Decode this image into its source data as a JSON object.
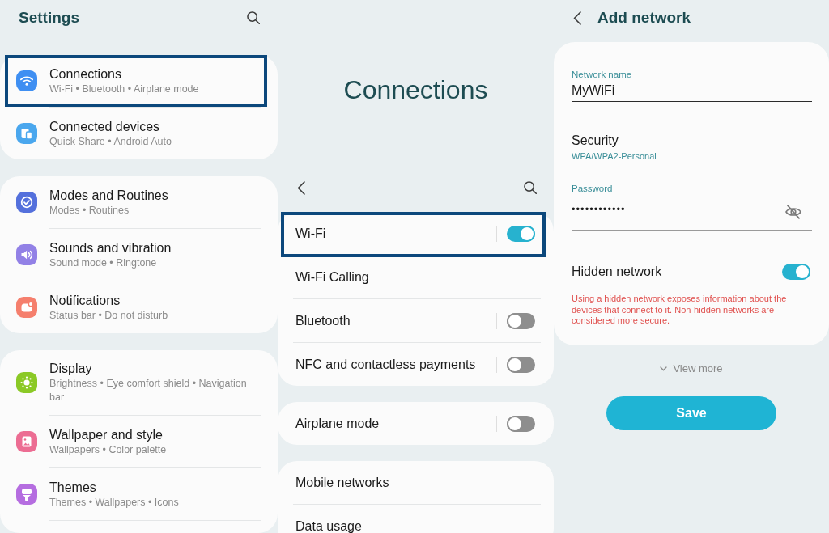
{
  "settings_panel": {
    "title": "Settings",
    "groups": [
      {
        "items": [
          {
            "title": "Connections",
            "subtitle": "Wi-Fi • Bluetooth • Airplane mode",
            "color": "#3f8ff2",
            "highlighted": true
          },
          {
            "title": "Connected devices",
            "subtitle": "Quick Share • Android Auto",
            "color": "#4aa7ee",
            "highlighted": false
          }
        ]
      },
      {
        "items": [
          {
            "title": "Modes and Routines",
            "subtitle": "Modes • Routines",
            "color": "#5470dc",
            "highlighted": false
          },
          {
            "title": "Sounds and vibration",
            "subtitle": "Sound mode • Ringtone",
            "color": "#9281e6",
            "highlighted": false
          },
          {
            "title": "Notifications",
            "subtitle": "Status bar • Do not disturb",
            "color": "#f57f6d",
            "highlighted": false
          }
        ]
      },
      {
        "items": [
          {
            "title": "Display",
            "subtitle": "Brightness • Eye comfort shield • Navigation bar",
            "color": "#8bc926",
            "highlighted": false
          },
          {
            "title": "Wallpaper and style",
            "subtitle": "Wallpapers • Color palette",
            "color": "#ec6d93",
            "highlighted": false
          },
          {
            "title": "Themes",
            "subtitle": "Themes • Wallpapers • Icons",
            "color": "#b56de0",
            "highlighted": false
          }
        ]
      }
    ]
  },
  "connections_panel": {
    "title": "Connections",
    "groups": [
      {
        "items": [
          {
            "label": "Wi-Fi",
            "kind": "toggle",
            "on": true,
            "highlighted": true
          },
          {
            "label": "Wi-Fi Calling",
            "kind": "link",
            "highlighted": false
          },
          {
            "label": "Bluetooth",
            "kind": "toggle",
            "on": false,
            "highlighted": false
          },
          {
            "label": "NFC and contactless payments",
            "kind": "toggle",
            "on": false,
            "highlighted": false
          }
        ]
      },
      {
        "items": [
          {
            "label": "Airplane mode",
            "kind": "toggle",
            "on": false,
            "highlighted": false
          }
        ]
      },
      {
        "items": [
          {
            "label": "Mobile networks",
            "kind": "link",
            "highlighted": false
          },
          {
            "label": "Data usage",
            "kind": "link",
            "highlighted": false
          }
        ]
      }
    ]
  },
  "add_network_panel": {
    "title": "Add network",
    "network_name": {
      "label": "Network name",
      "value": "MyWiFi"
    },
    "security": {
      "label": "Security",
      "value": "WPA/WPA2-Personal"
    },
    "password": {
      "label": "Password",
      "value": "••••••••••••"
    },
    "hidden_network": {
      "label": "Hidden network",
      "on": true
    },
    "warning": "Using a hidden network exposes information about the devices that connect to it. Non-hidden networks are considered more secure.",
    "view_more": "View more",
    "save_button": "Save"
  }
}
